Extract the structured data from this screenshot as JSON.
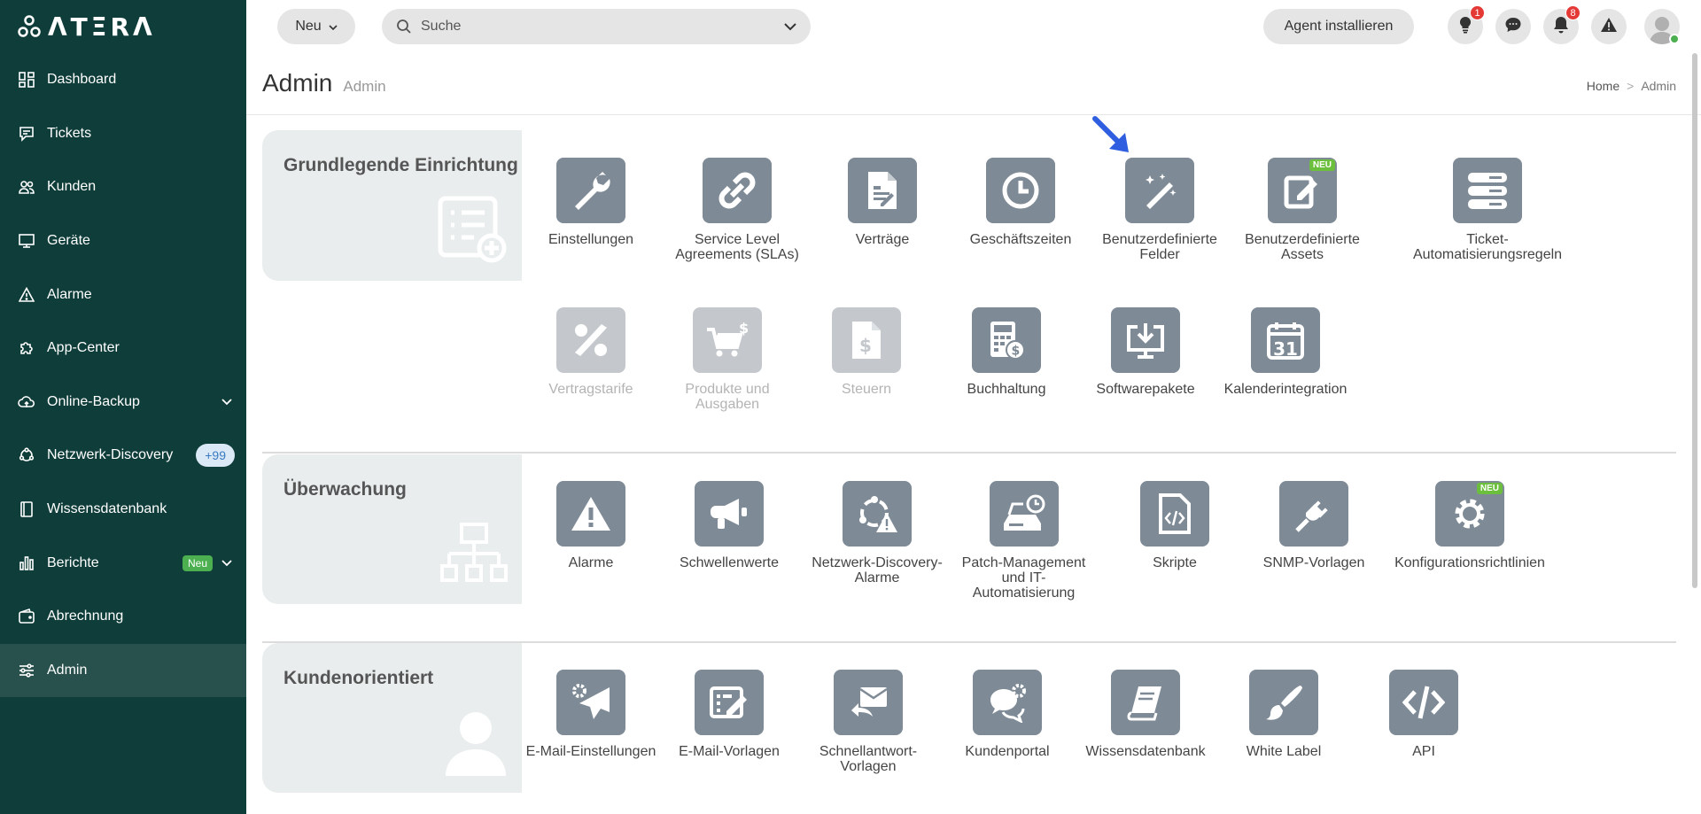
{
  "app": {
    "logo_text": "ΛTΞRΛ"
  },
  "sidebar": {
    "items": [
      {
        "label": "Dashboard",
        "icon": "dashboard-icon"
      },
      {
        "label": "Tickets",
        "icon": "ticket-icon"
      },
      {
        "label": "Kunden",
        "icon": "customers-icon"
      },
      {
        "label": "Geräte",
        "icon": "monitor-icon"
      },
      {
        "label": "Alarme",
        "icon": "warning-icon"
      },
      {
        "label": "App-Center",
        "icon": "puzzle-icon"
      },
      {
        "label": "Online-Backup",
        "icon": "cloud-icon"
      },
      {
        "label": "Netzwerk-Discovery",
        "icon": "network-icon",
        "badge": "+99"
      },
      {
        "label": "Wissensdatenbank",
        "icon": "book-icon"
      },
      {
        "label": "Berichte",
        "icon": "bar-chart-icon",
        "tag": "Neu"
      },
      {
        "label": "Abrechnung",
        "icon": "wallet-icon"
      },
      {
        "label": "Admin",
        "icon": "sliders-icon"
      }
    ]
  },
  "topbar": {
    "new_label": "Neu",
    "search_placeholder": "Suche",
    "agent_label": "Agent installieren",
    "hint_badge": "1",
    "notif_badge": "8"
  },
  "page": {
    "title": "Admin",
    "subtitle": "Admin",
    "breadcrumb": {
      "home": "Home",
      "sep": ">",
      "current": "Admin"
    }
  },
  "sections": {
    "basic": {
      "title": "Grundlegende Einrichtung",
      "tiles": [
        {
          "label": "Einstellungen"
        },
        {
          "label": "Service Level Agreements (SLAs)"
        },
        {
          "label": "Verträge"
        },
        {
          "label": "Geschäftszeiten"
        },
        {
          "label": "Benutzerdefinierte Felder"
        },
        {
          "label": "Benutzerdefinierte Assets",
          "tag": "NEU"
        },
        {
          "label": "Ticket-Automatisierungsregeln"
        },
        {
          "label": "Vertragstarife",
          "disabled": true
        },
        {
          "label": "Produkte und Ausgaben",
          "disabled": true
        },
        {
          "label": "Steuern",
          "disabled": true
        },
        {
          "label": "Buchhaltung"
        },
        {
          "label": "Softwarepakete"
        },
        {
          "label": "Kalenderintegration",
          "cal_day": "31"
        }
      ]
    },
    "monitoring": {
      "title": "Überwachung",
      "tiles": [
        {
          "label": "Alarme"
        },
        {
          "label": "Schwellenwerte"
        },
        {
          "label": "Netzwerk-Discovery-Alarme"
        },
        {
          "label": "Patch-Management und IT-Automatisierung"
        },
        {
          "label": "Skripte"
        },
        {
          "label": "SNMP-Vorlagen"
        },
        {
          "label": "Konfigurationsrichtlinien",
          "tag": "NEU"
        }
      ]
    },
    "customer": {
      "title": "Kundenorientiert",
      "tiles": [
        {
          "label": "E-Mail-Einstellungen"
        },
        {
          "label": "E-Mail-Vorlagen"
        },
        {
          "label": "Schnellantwort-Vorlagen"
        },
        {
          "label": "Kundenportal"
        },
        {
          "label": "Wissensdatenbank"
        },
        {
          "label": "White Label"
        },
        {
          "label": "API"
        }
      ]
    }
  }
}
